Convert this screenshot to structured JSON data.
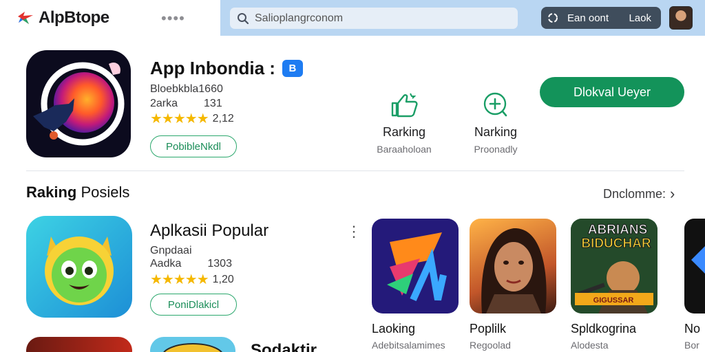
{
  "header": {
    "logo_text": "AlpBtope",
    "more_label": "••••",
    "search_placeholder": "Salioplangrconom",
    "account_label": "Ean oont",
    "account_label2": "Laok"
  },
  "featured": {
    "title": "App Inbondia :",
    "badge": "B",
    "developer": "Bloebkbla",
    "developer_num": "1660",
    "category": "2arka",
    "category_num": "131",
    "stars": "★★★★★",
    "rating": "2,12",
    "outline_button": "PobibleNkdl",
    "stats": [
      {
        "title": "Rarking",
        "subtitle": "Baraaholoan",
        "icon": "thumbs-up-icon"
      },
      {
        "title": "Narking",
        "subtitle": "Proonadly",
        "icon": "plus-circle-icon"
      }
    ],
    "primary_button": "Dlokval Ueyer"
  },
  "section": {
    "title_bold": "Raking",
    "title_rest": " Posiels",
    "see_all": "Dnclomme:",
    "see_all_chevron": "›"
  },
  "list_item": {
    "title": "Aplkasii Popular",
    "developer": "Gnpdaai",
    "category": "Aadka",
    "category_num": "1303",
    "stars": "★★★★★",
    "rating": "1,20",
    "outline_button": "PoniDlakicl",
    "kebab": "⋮"
  },
  "grid": [
    {
      "title": "Laoking",
      "subtitle": "Adebitsalamimes"
    },
    {
      "title": "Poplilk",
      "subtitle": "Regoolad"
    },
    {
      "title": "Spldkogrina",
      "subtitle": "Alodesta",
      "banner_line1": "ABRIANS",
      "banner_line2": "BIDUCHAR",
      "banner_footer": "GIGUSSAR"
    },
    {
      "title": "No",
      "subtitle": "Bor"
    }
  ],
  "bottom": {
    "title": "Sodaktir"
  },
  "colors": {
    "accent_green": "#13935a",
    "badge_blue": "#1e7cf2",
    "search_panel": "#b9d6f2",
    "star": "#f5b800"
  }
}
